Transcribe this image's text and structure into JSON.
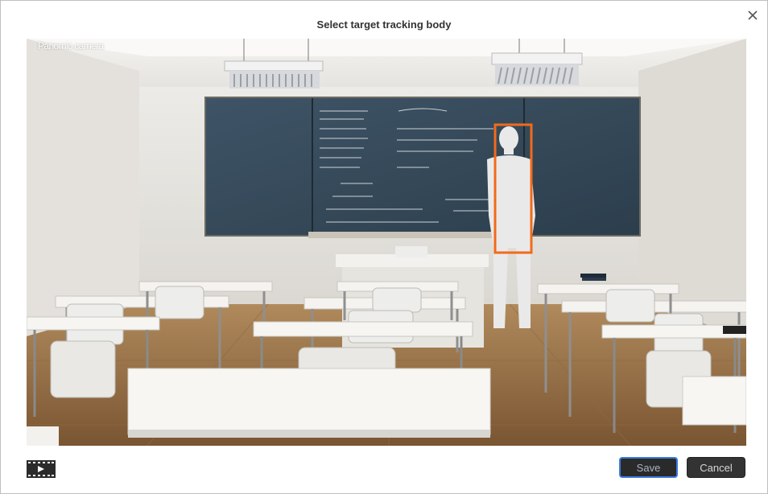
{
  "dialog": {
    "title": "Select target tracking body",
    "close_icon": "close-icon"
  },
  "camera": {
    "label": "Panomic camera",
    "tracking_box_color": "#f26a1b"
  },
  "footer": {
    "video_icon": "film-play-icon",
    "save_label": "Save",
    "cancel_label": "Cancel"
  },
  "colors": {
    "save_border": "#3c7bdc",
    "button_bg": "#2a2a2a"
  }
}
